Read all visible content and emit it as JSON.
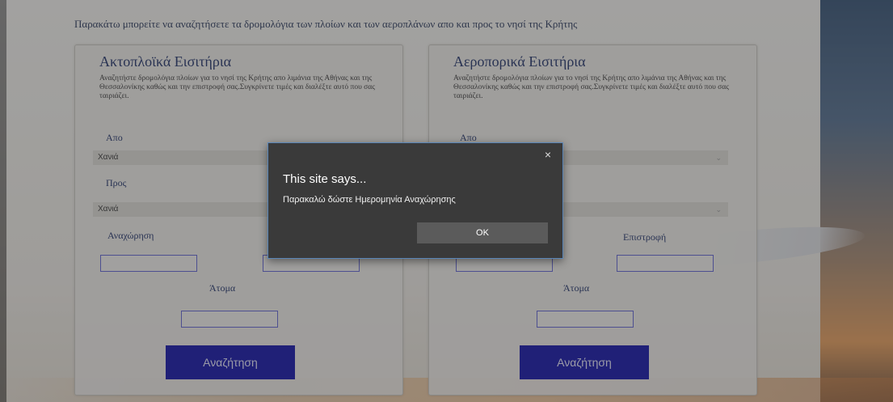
{
  "intro": "Παρακάτω μπορείτε να αναζητήσετε τα δρομολόγια των πλοίων και των αεροπλάνων απο και προς το νησί της Κρήτης",
  "ferry": {
    "title": "Ακτοπλοϊκά Εισιτήρια",
    "desc": "Αναζητήστε δρομολόγια πλοίων για το νησί της Κρήτης απο λιμάνια της Αθήνας και της Θεσσαλονίκης καθώς και την επιστροφή σας.Συγκρίνετε τιμές και διαλέξτε αυτό που σας ταιριάζει.",
    "from_label": "Απο",
    "from_value": "Χανιά",
    "to_label": "Προς",
    "to_value": "Χανιά",
    "departure_label": "Αναχώρηση",
    "people_label": "Άτομα",
    "search_button": "Αναζήτηση"
  },
  "flights": {
    "title": "Αεροπορικά Εισιτήρια",
    "desc": "Αναζητήστε δρομολόγια πλοίων για το νησί της Κρήτης απο λιμάνια της Αθήνας και της Θεσσαλονίκης καθώς και την επιστροφή σας.Συγκρίνετε τιμές και διαλέξτε αυτό που σας ταιριάζει.",
    "from_label": "Απο",
    "return_label": "Επιστροφή",
    "people_label": "Άτομα",
    "search_button": "Αναζήτηση"
  },
  "dialog": {
    "title": "This site says...",
    "message": "Παρακαλώ δώστε Ημερομηνία Αναχώρησης",
    "ok": "OK",
    "close": "×"
  },
  "icons": {
    "chevron": "chevron-down-icon",
    "close": "close-icon"
  },
  "colors": {
    "button": "#0a0aa8",
    "heading": "#1a2d66",
    "field_border": "#5b5fd6",
    "dialog_bg": "#3a3a3a"
  }
}
